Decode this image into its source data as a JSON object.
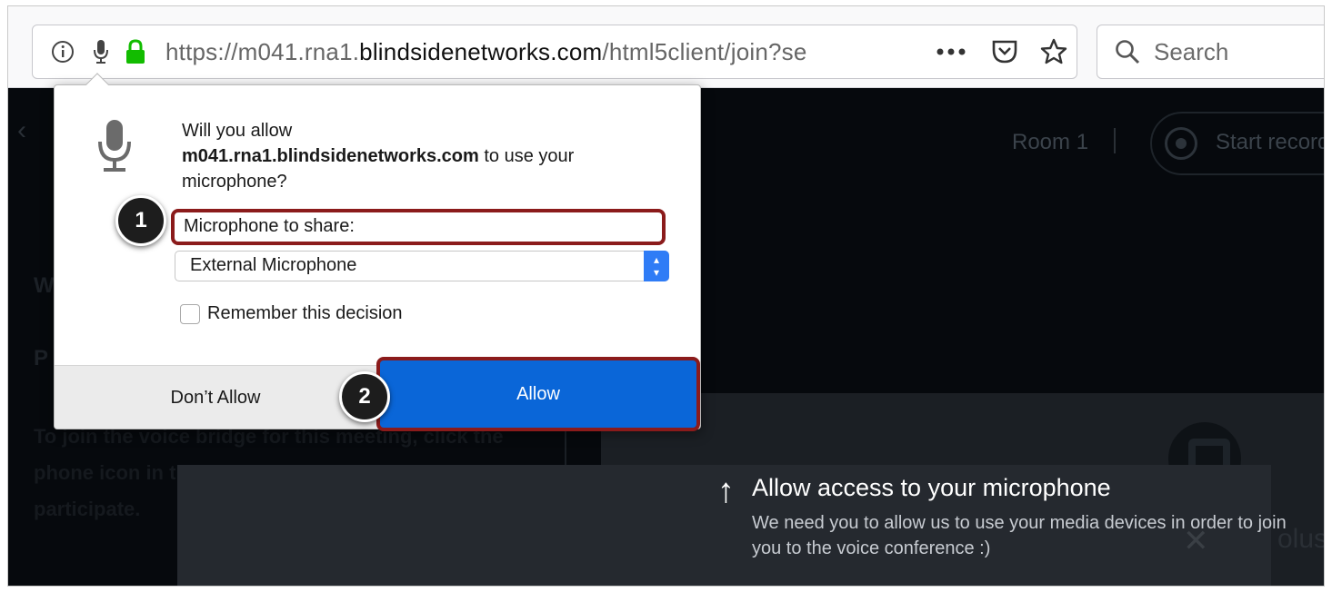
{
  "browser": {
    "url": {
      "prefix": "https://m041.rna1.",
      "domain": "blindsidenetworks.com",
      "path": "/html5client/join?se"
    },
    "search_placeholder": "Search",
    "icons": [
      "info-icon",
      "microphone-icon",
      "lock-icon",
      "more-actions-icon",
      "pocket-icon",
      "star-icon",
      "search-icon"
    ]
  },
  "page": {
    "room_label": "Room 1",
    "recording_label": "Start recording",
    "bg_text": "To join the voice bridge for this meeting, click the phone icon in the lower toolbar or use your headset to participate.",
    "letter_w": "W",
    "letter_p": "P",
    "edge_text": "olus"
  },
  "popup": {
    "question_prefix": "Will you allow",
    "domain": "m041.rna1.blindsidenetworks.com",
    "question_suffix": "to use your microphone?",
    "mic_to_share_label": "Microphone to share:",
    "selected_microphone": "External Microphone",
    "remember_label": "Remember this decision",
    "remember_checked": false,
    "dont_allow_label": "Don’t Allow",
    "allow_label": "Allow"
  },
  "toast": {
    "title": "Allow access to your microphone",
    "body": "We need you to allow us to use your media devices in order to join you to the voice conference :)"
  },
  "steps": {
    "one": "1",
    "two": "2"
  },
  "colors": {
    "highlight": "#8b1b1b",
    "allow_button": "#0a66d8",
    "page_bg": "#06090d",
    "toast_bg": "#25292f"
  }
}
